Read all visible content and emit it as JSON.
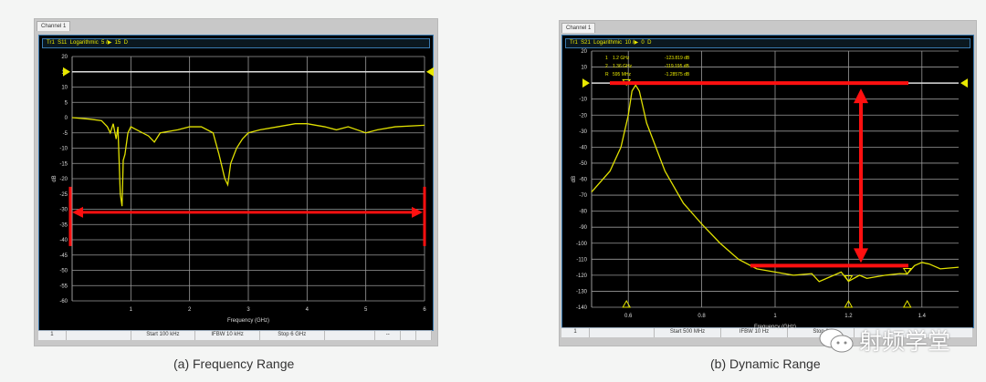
{
  "chart_data": [
    {
      "type": "line",
      "panel_tab": "Channel 1",
      "trace_header": "Tr1  S11  Logarithmic  5 /▶  15  D",
      "xlabel": "Frequency (GHz)",
      "ylabel": "dB",
      "xlim": [
        0,
        6
      ],
      "ylim": [
        -60,
        20
      ],
      "x_ticks": [
        "1",
        "2",
        "3",
        "4",
        "5",
        "6"
      ],
      "y_ticks": [
        "20",
        "15",
        "10",
        "5",
        "0",
        "-5",
        "-10",
        "-15",
        "-20",
        "-25",
        "-30",
        "-35",
        "-40",
        "-45",
        "-50",
        "-55",
        "-60"
      ],
      "grid": true,
      "reference_level": 15,
      "trace_color": "#e0e000",
      "series": [
        {
          "x": [
            0,
            0.3,
            0.5,
            0.6,
            0.65,
            0.7,
            0.75,
            0.78,
            0.82,
            0.85,
            0.87,
            0.9,
            0.95,
            1.0,
            1.1,
            1.3,
            1.4,
            1.5,
            1.8,
            2.0,
            2.2,
            2.4,
            2.5,
            2.6,
            2.65,
            2.7,
            2.8,
            2.9,
            3.0,
            3.2,
            3.5,
            3.8,
            4.0,
            4.3,
            4.5,
            4.7,
            5.0,
            5.2,
            5.5,
            6.0
          ],
          "y": [
            0,
            -0.5,
            -1,
            -3,
            -5,
            -2,
            -7,
            -3,
            -25,
            -29,
            -14,
            -12,
            -5,
            -3,
            -4,
            -6,
            -8,
            -5,
            -4,
            -3,
            -3,
            -5,
            -12,
            -20,
            -22,
            -15,
            -10,
            -7,
            -5,
            -4,
            -3,
            -2,
            -2,
            -3,
            -4,
            -3,
            -5,
            -4,
            -3,
            -2.5
          ]
        }
      ],
      "status": [
        "1",
        "Start 100 kHz",
        "IFBW 10 kHz",
        "Stop 6 GHz",
        "--"
      ],
      "annotation": {
        "type": "double-arrow-horizontal",
        "at_db": -31,
        "color": "#ff1010"
      },
      "caption": "(a) Frequency Range"
    },
    {
      "type": "line",
      "panel_tab": "Channel 1",
      "trace_header": "Tr1  S21  Logarithmic  10 /▶  0  D",
      "xlabel": "Frequency (GHz)",
      "ylabel": "dB",
      "xlim": [
        0.5,
        1.5
      ],
      "ylim": [
        -140,
        20
      ],
      "x_ticks": [
        "0.6",
        "0.8",
        "1",
        "1.2",
        "1.4"
      ],
      "y_ticks": [
        "20",
        "10",
        "0",
        "-10",
        "-20",
        "-30",
        "-40",
        "-50",
        "-60",
        "-70",
        "-80",
        "-90",
        "-100",
        "-110",
        "-120",
        "-130",
        "-140"
      ],
      "grid": true,
      "reference_level": 0,
      "trace_color": "#e0e000",
      "series": [
        {
          "x": [
            0.5,
            0.55,
            0.58,
            0.6,
            0.61,
            0.62,
            0.63,
            0.65,
            0.7,
            0.75,
            0.8,
            0.85,
            0.9,
            0.95,
            1.0,
            1.05,
            1.1,
            1.12,
            1.15,
            1.18,
            1.2,
            1.23,
            1.25,
            1.3,
            1.34,
            1.36,
            1.38,
            1.4,
            1.42,
            1.45,
            1.5
          ],
          "y": [
            -68,
            -55,
            -40,
            -20,
            -5,
            -1.3,
            -5,
            -25,
            -55,
            -75,
            -88,
            -100,
            -110,
            -116,
            -118,
            -120,
            -119,
            -124,
            -121,
            -118,
            -123.8,
            -120,
            -122,
            -120,
            -119,
            -119.2,
            -114,
            -112,
            -113,
            -116,
            -115
          ]
        }
      ],
      "markers": [
        {
          "id": "1",
          "freq": "1.2 GHz",
          "value": "-123.819 dB"
        },
        {
          "id": "2",
          "freq": "1.36 GHz",
          "value": "-119.195 dB"
        },
        {
          "id": "R",
          "freq": "595 MHz",
          "value": "-1.28575 dB"
        }
      ],
      "status": [
        "1",
        "Start 500 MHz",
        "IFBW 10 Hz",
        "Stop 1"
      ],
      "annotation": {
        "type": "dynamic-range-arrow",
        "top_db": 0,
        "bottom_db": -114,
        "color": "#ff1010"
      },
      "caption": "(b) Dynamic Range"
    }
  ],
  "watermark": "射频学堂"
}
